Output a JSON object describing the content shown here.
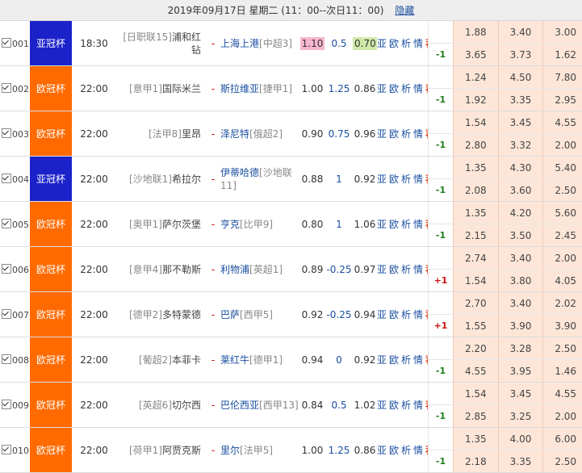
{
  "header": {
    "date_text": "2019年09月17日 星期二 (11：00--次日11：00)",
    "hide_label": "隐藏"
  },
  "colors": {
    "asia_cup": "#1b22c9",
    "euro_cup": "#ff6a00",
    "odds_bg": "#fde6d8"
  },
  "links": {
    "asia": "亚",
    "euro": "欧",
    "analysis": "析",
    "intel": "情",
    "recommend": "荐"
  },
  "matches": [
    {
      "no": "001",
      "league": "亚冠杯",
      "league_type": "asia",
      "time": "18:30",
      "home_rank": "[日职联15]",
      "home_team": "浦和红钻",
      "vs": "-",
      "away_team": "上海上港",
      "away_rank": "[中超3]",
      "odds1": "1.10",
      "handicap": "0.5",
      "odds2": "0.70",
      "signal": "-1",
      "euro_top": [
        "1.88",
        "3.40",
        "3.00"
      ],
      "euro_bottom": [
        "3.65",
        "3.73",
        "1.62"
      ]
    },
    {
      "no": "002",
      "league": "欧冠杯",
      "league_type": "euro",
      "time": "22:00",
      "home_rank": "[意甲1]",
      "home_team": "国际米兰",
      "vs": "-",
      "away_team": "斯拉维亚",
      "away_rank": "[捷甲1]",
      "odds1": "1.00",
      "handicap": "1.25",
      "odds2": "0.86",
      "signal": "-1",
      "euro_top": [
        "1.24",
        "4.50",
        "7.80"
      ],
      "euro_bottom": [
        "1.92",
        "3.35",
        "2.95"
      ]
    },
    {
      "no": "003",
      "league": "欧冠杯",
      "league_type": "euro",
      "time": "22:00",
      "home_rank": "[法甲8]",
      "home_team": "里昂",
      "vs": "-",
      "away_team": "泽尼特",
      "away_rank": "[俄超2]",
      "odds1": "0.90",
      "handicap": "0.75",
      "odds2": "0.96",
      "signal": "-1",
      "euro_top": [
        "1.54",
        "3.45",
        "4.55"
      ],
      "euro_bottom": [
        "2.80",
        "3.32",
        "2.00"
      ]
    },
    {
      "no": "004",
      "league": "亚冠杯",
      "league_type": "asia",
      "time": "22:00",
      "home_rank": "[沙地联1]",
      "home_team": "希拉尔",
      "vs": "-",
      "away_team": "伊蒂哈德",
      "away_rank": "[沙地联11]",
      "odds1": "0.88",
      "handicap": "1",
      "odds2": "0.92",
      "signal": "-1",
      "euro_top": [
        "1.35",
        "4.30",
        "5.40"
      ],
      "euro_bottom": [
        "2.08",
        "3.60",
        "2.50"
      ]
    },
    {
      "no": "005",
      "league": "欧冠杯",
      "league_type": "euro",
      "time": "22:00",
      "home_rank": "[奥甲1]",
      "home_team": "萨尔茨堡",
      "vs": "-",
      "away_team": "亨克",
      "away_rank": "[比甲9]",
      "odds1": "0.80",
      "handicap": "1",
      "odds2": "1.06",
      "signal": "-1",
      "euro_top": [
        "1.35",
        "4.20",
        "5.60"
      ],
      "euro_bottom": [
        "2.15",
        "3.50",
        "2.45"
      ]
    },
    {
      "no": "006",
      "league": "欧冠杯",
      "league_type": "euro",
      "time": "22:00",
      "home_rank": "[意甲4]",
      "home_team": "那不勒斯",
      "vs": "-",
      "away_team": "利物浦",
      "away_rank": "[英超1]",
      "odds1": "0.89",
      "handicap": "-0.25",
      "odds2": "0.97",
      "signal": "+1",
      "euro_top": [
        "2.74",
        "3.40",
        "2.00"
      ],
      "euro_bottom": [
        "1.54",
        "3.80",
        "4.05"
      ]
    },
    {
      "no": "007",
      "league": "欧冠杯",
      "league_type": "euro",
      "time": "22:00",
      "home_rank": "[德甲2]",
      "home_team": "多特蒙德",
      "vs": "-",
      "away_team": "巴萨",
      "away_rank": "[西甲5]",
      "odds1": "0.92",
      "handicap": "-0.25",
      "odds2": "0.94",
      "signal": "+1",
      "euro_top": [
        "2.70",
        "3.40",
        "2.02"
      ],
      "euro_bottom": [
        "1.55",
        "3.90",
        "3.90"
      ]
    },
    {
      "no": "008",
      "league": "欧冠杯",
      "league_type": "euro",
      "time": "22:00",
      "home_rank": "[葡超2]",
      "home_team": "本菲卡",
      "vs": "-",
      "away_team": "莱红牛",
      "away_rank": "[德甲1]",
      "odds1": "0.94",
      "handicap": "0",
      "odds2": "0.92",
      "signal": "-1",
      "euro_top": [
        "2.20",
        "3.28",
        "2.50"
      ],
      "euro_bottom": [
        "4.55",
        "3.95",
        "1.46"
      ]
    },
    {
      "no": "009",
      "league": "欧冠杯",
      "league_type": "euro",
      "time": "22:00",
      "home_rank": "[英超6]",
      "home_team": "切尔西",
      "vs": "-",
      "away_team": "巴伦西亚",
      "away_rank": "[西甲13]",
      "odds1": "0.84",
      "handicap": "0.5",
      "odds2": "1.02",
      "signal": "-1",
      "euro_top": [
        "1.54",
        "3.45",
        "4.55"
      ],
      "euro_bottom": [
        "2.85",
        "3.25",
        "2.00"
      ]
    },
    {
      "no": "010",
      "league": "欧冠杯",
      "league_type": "euro",
      "time": "22:00",
      "home_rank": "[荷甲1]",
      "home_team": "阿贾克斯",
      "vs": "-",
      "away_team": "里尔",
      "away_rank": "[法甲5]",
      "odds1": "1.00",
      "handicap": "1.25",
      "odds2": "0.86",
      "signal": "-1",
      "euro_top": [
        "1.35",
        "4.00",
        "6.00"
      ],
      "euro_bottom": [
        "2.18",
        "3.35",
        "2.50"
      ]
    }
  ]
}
